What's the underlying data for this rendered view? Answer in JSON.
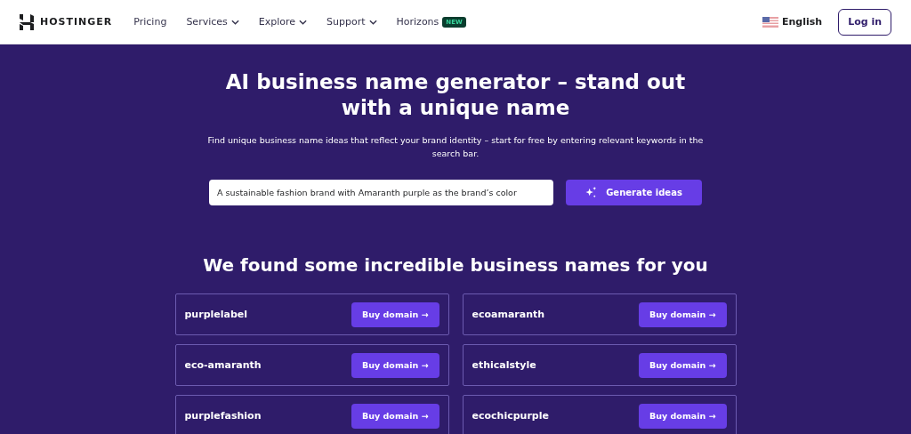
{
  "header": {
    "logo": "HOSTINGER",
    "nav": [
      {
        "label": "Pricing",
        "dropdown": false
      },
      {
        "label": "Services",
        "dropdown": true
      },
      {
        "label": "Explore",
        "dropdown": true
      },
      {
        "label": "Support",
        "dropdown": true
      },
      {
        "label": "Horizons",
        "dropdown": false,
        "badge": "NEW"
      }
    ],
    "language": "English",
    "login": "Log in"
  },
  "hero": {
    "title": "AI business name generator – stand out with a unique name",
    "subtitle": "Find unique business name ideas that reflect your brand identity – start for free by entering relevant keywords in the search bar.",
    "search": {
      "value": "A sustainable fashion brand with Amaranth purple as the brand’s color"
    },
    "button": "Generate ideas"
  },
  "results": {
    "heading": "We found some incredible business names for you",
    "names": [
      {
        "name": "purplelabel",
        "action": "Buy domain →"
      },
      {
        "name": "ecoamaranth",
        "action": "Buy domain →"
      },
      {
        "name": "eco-amaranth",
        "action": "Buy domain →"
      },
      {
        "name": "ethicalstyle",
        "action": "Buy domain →"
      },
      {
        "name": "purplefashion",
        "action": "Buy domain →"
      },
      {
        "name": "ecochicpurple",
        "action": "Buy domain →"
      }
    ]
  }
}
